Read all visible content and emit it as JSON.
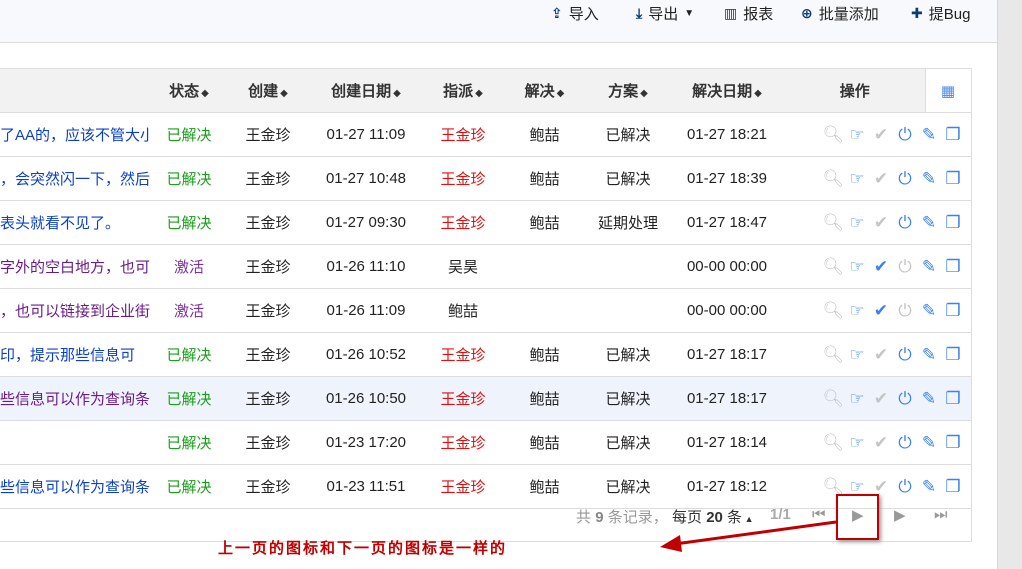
{
  "toolbar": {
    "import": "导入",
    "export": "导出",
    "report": "报表",
    "batch_add": "批量添加",
    "report_bug": "提Bug"
  },
  "headers": [
    "状态",
    "创建",
    "创建日期",
    "指派",
    "解决",
    "方案",
    "解决日期",
    "操作"
  ],
  "rows": [
    {
      "title": "了AA的，应该不管大小",
      "visited": false,
      "status": "已解决",
      "creator": "王金珍",
      "created": "01-27 11:09",
      "assignee": "王金珍",
      "resolver": "鲍喆",
      "solution": "已解决",
      "resolved": "01-27 18:21",
      "confirmed": false
    },
    {
      "title": "，会突然闪一下，然后",
      "visited": false,
      "status": "已解决",
      "creator": "王金珍",
      "created": "01-27 10:48",
      "assignee": "王金珍",
      "resolver": "鲍喆",
      "solution": "已解决",
      "resolved": "01-27 18:39",
      "confirmed": false
    },
    {
      "title": "表头就看不见了。",
      "visited": false,
      "status": "已解决",
      "creator": "王金珍",
      "created": "01-27 09:30",
      "assignee": "王金珍",
      "resolver": "鲍喆",
      "solution": "延期处理",
      "resolved": "01-27 18:47",
      "confirmed": false
    },
    {
      "title": "字外的空白地方，也可",
      "visited": true,
      "status": "激活",
      "creator": "王金珍",
      "created": "01-26 11:10",
      "assignee": "吴昊",
      "resolver": "",
      "solution": "",
      "resolved": "00-00 00:00",
      "confirmed": true
    },
    {
      "title": "，也可以链接到企业街",
      "visited": true,
      "status": "激活",
      "creator": "王金珍",
      "created": "01-26 11:09",
      "assignee": "鲍喆",
      "resolver": "",
      "solution": "",
      "resolved": "00-00 00:00",
      "confirmed": true
    },
    {
      "title": "印，提示那些信息可",
      "visited": false,
      "status": "已解决",
      "creator": "王金珍",
      "created": "01-26 10:52",
      "assignee": "王金珍",
      "resolver": "鲍喆",
      "solution": "已解决",
      "resolved": "01-27 18:17",
      "confirmed": false
    },
    {
      "title": "些信息可以作为查询条",
      "visited": true,
      "status": "已解决",
      "creator": "王金珍",
      "created": "01-26 10:50",
      "assignee": "王金珍",
      "resolver": "鲍喆",
      "solution": "已解决",
      "resolved": "01-27 18:17",
      "confirmed": false
    },
    {
      "title": "",
      "visited": false,
      "status": "已解决",
      "creator": "王金珍",
      "created": "01-23 17:20",
      "assignee": "王金珍",
      "resolver": "鲍喆",
      "solution": "已解决",
      "resolved": "01-27 18:14",
      "confirmed": false
    },
    {
      "title": "些信息可以作为查询条",
      "visited": false,
      "status": "已解决",
      "creator": "王金珍",
      "created": "01-23 11:51",
      "assignee": "王金珍",
      "resolver": "鲍喆",
      "solution": "已解决",
      "resolved": "01-27 18:12",
      "confirmed": false
    }
  ],
  "pager": {
    "total_prefix": "共",
    "total": "9",
    "total_suffix": "条记录，",
    "per_page_prefix": "每页",
    "per_page": "20",
    "per_page_suffix": "条",
    "page": "1/1"
  },
  "annotation": "上一页的图标和下一页的图标是一样的"
}
